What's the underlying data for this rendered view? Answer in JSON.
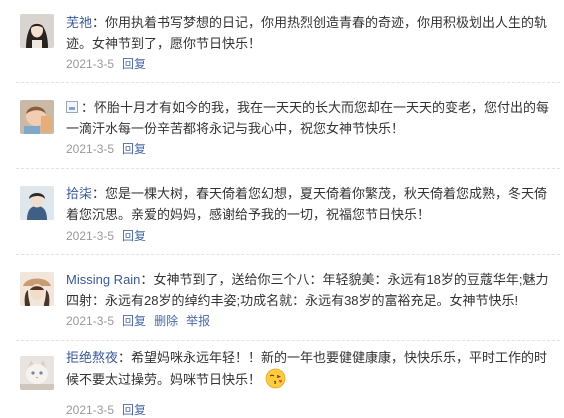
{
  "comments": [
    {
      "user": "芜祂",
      "colon": "：",
      "text": "你用执着书写梦想的日记，你用热烈创造青春的奇迹，你用积极划出人生的轨迹。女神节到了，愿你节日快乐！",
      "date": "2021-3-5",
      "actions": [
        "回复"
      ]
    },
    {
      "user": "",
      "colon": "：",
      "text": "怀胎十月才有如今的我，我在一天天的长大而您却在一天天的变老，您付出的每一滴汗水每一份辛苦都将永记与我心中，祝您女神节快乐！",
      "date": "2021-3-5",
      "actions": [
        "回复"
      ]
    },
    {
      "user": "拾柒",
      "colon": "：",
      "text": "您是一棵大树，春天倚着您幻想，夏天倚着你繁茂，秋天倚着您成熟，冬天倚着您沉思。亲爱的妈妈，感谢给予我的一切，祝福您节日快乐！",
      "date": "2021-3-5",
      "actions": [
        "回复"
      ]
    },
    {
      "user": "Missing Rain",
      "colon": "：",
      "text": "女神节到了，送给你三个八：年轻貌美：永远有18岁的豆蔻华年;魅力四射：永远有28岁的绰约丰姿;功成名就：永远有38岁的富裕充足。女神节快乐!",
      "date": "2021-3-5",
      "actions": [
        "回复",
        "删除",
        "举报"
      ]
    },
    {
      "user": "拒绝熬夜",
      "colon": "：",
      "text": "希望妈咪永远年轻！！新的一年也要健健康康，快快乐乐，平时工作的时候不要太过操劳。妈咪节日快乐！",
      "date": "2021-3-5",
      "actions": [
        "回复"
      ]
    }
  ],
  "icons": {
    "avatar_0": "girl-portrait-avatar",
    "avatar_1": "baby-photo-avatar",
    "avatar_2": "boy-portrait-avatar",
    "avatar_3": "girl-with-hat-avatar",
    "avatar_4": "cat-photo-avatar",
    "broken": "broken-image-icon",
    "emoji": "kissing-face-emoji-icon"
  },
  "colors": {
    "username": "#3b5998",
    "text": "#333333",
    "meta": "#999999",
    "action": "#4a6aa5"
  }
}
